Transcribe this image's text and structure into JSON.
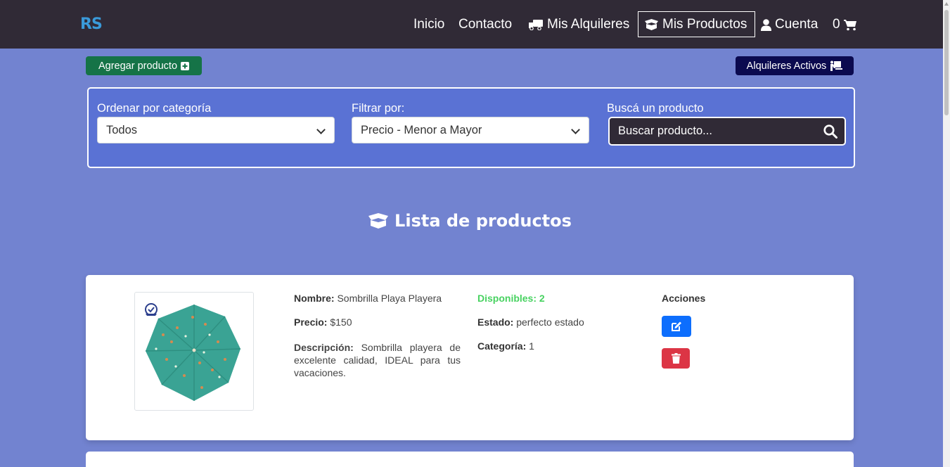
{
  "navbar": {
    "logo": "RS",
    "items": [
      {
        "label": "Inicio",
        "icon": ""
      },
      {
        "label": "Contacto",
        "icon": ""
      },
      {
        "label": "Mis Alquileres",
        "icon": "truck-icon"
      },
      {
        "label": "Mis Productos",
        "icon": "box-open-icon"
      },
      {
        "label": "Cuenta",
        "icon": "user-icon"
      },
      {
        "label": "0",
        "icon": "cart-icon"
      }
    ],
    "active": "Mis Productos"
  },
  "actions": {
    "add_product": "Agregar producto",
    "active_rentals": "Alquileres Activos"
  },
  "filters": {
    "category_label": "Ordenar por categoría",
    "category_value": "Todos",
    "filter_label": "Filtrar por:",
    "filter_value": "Precio - Menor a Mayor",
    "search_label": "Buscá un producto",
    "search_placeholder": "Buscar producto..."
  },
  "list": {
    "title": "Lista de productos"
  },
  "products": [
    {
      "name_label": "Nombre:",
      "name": "Sombrilla Playa Playera",
      "price_label": "Precio:",
      "price": "$150",
      "description_label": "Descripción:",
      "description": "Sombrilla playera de excelente calidad, IDEAL para tus vacaciones.",
      "available_text": "Disponibles: 2",
      "state_label": "Estado:",
      "state": "perfecto estado",
      "category_label": "Categoría:",
      "category": "1",
      "actions_label": "Acciones"
    }
  ],
  "colors": {
    "navbar": "#302a36",
    "background": "#7283d0",
    "panel": "#5a72d4",
    "add_button": "#157347",
    "active_button": "#0b0a4f",
    "edit_button": "#0d6efd",
    "delete_button": "#dc3545",
    "available": "#47d260",
    "umbrella": "#3aa394"
  }
}
